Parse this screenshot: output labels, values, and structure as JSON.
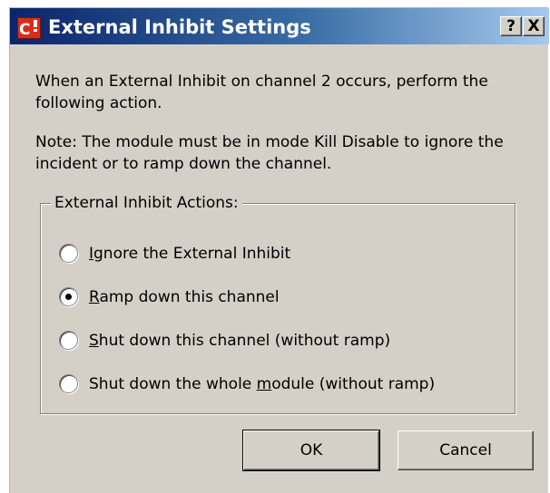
{
  "window": {
    "title": "External Inhibit Settings",
    "help_button": "?",
    "close_button": "X"
  },
  "description": {
    "line1": "When an External Inhibit on channel 2 occurs, perform the following action.",
    "line2": "Note: The module must be in mode Kill Disable to ignore the incident or to ramp down the channel."
  },
  "group": {
    "legend": "External Inhibit Actions:",
    "options": [
      {
        "mnemonic": "I",
        "rest": "gnore the External Inhibit",
        "selected": false
      },
      {
        "mnemonic": "R",
        "rest": "amp down this channel",
        "selected": true
      },
      {
        "mnemonic": "S",
        "rest": "hut down this channel (without ramp)",
        "selected": false
      },
      {
        "prefix": "Shut down the whole ",
        "mnemonic": "m",
        "rest": "odule (without ramp)",
        "selected": false
      }
    ]
  },
  "buttons": {
    "ok": "OK",
    "cancel": "Cancel"
  },
  "colors": {
    "titlebar_start": "#0a246a",
    "titlebar_end": "#a6caf0",
    "dialog_face": "#d4d0c8",
    "app_icon_red": "#d62e1a"
  },
  "icons": {
    "app": "app-logo-icon",
    "help": "help-icon",
    "close": "close-icon"
  }
}
